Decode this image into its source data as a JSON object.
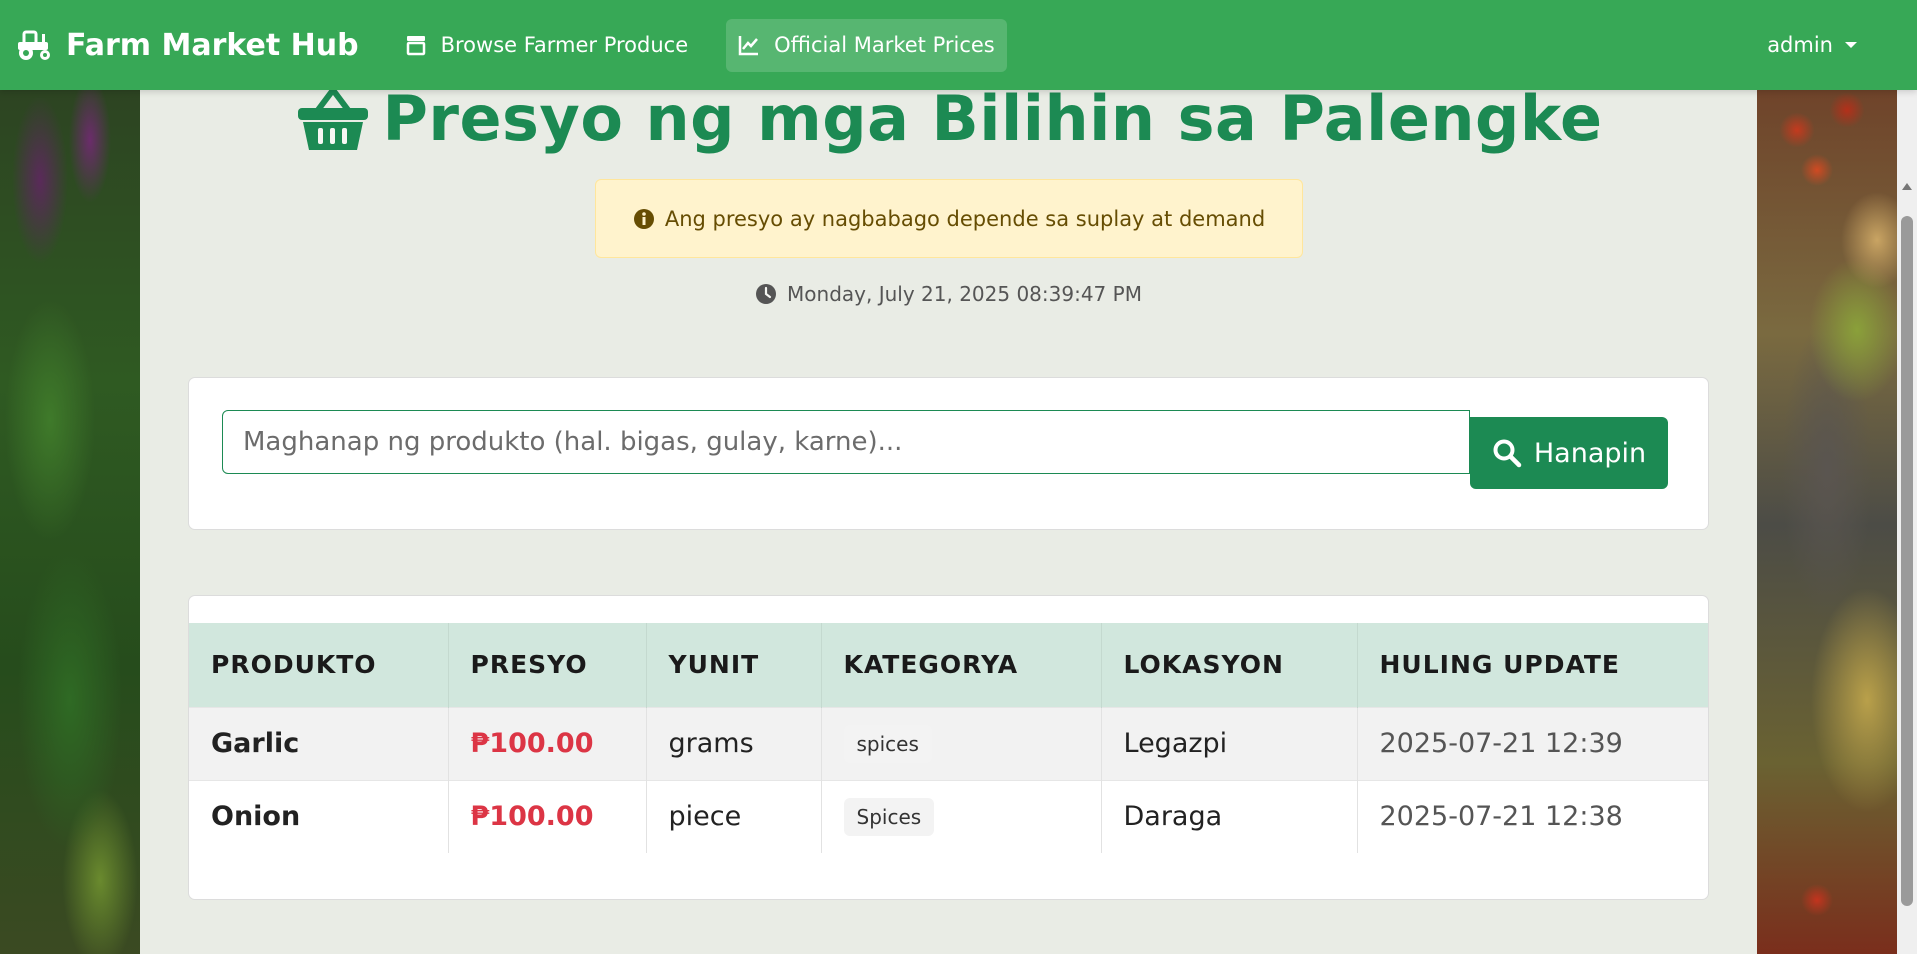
{
  "navbar": {
    "brand": "Farm Market Hub",
    "browse_label": "Browse Farmer Produce",
    "prices_label": "Official Market Prices",
    "user_label": "admin"
  },
  "main": {
    "title": "Presyo ng mga Bilihin sa Palengke",
    "notice": "Ang presyo ay nagbabago depende sa suplay at demand",
    "timestamp": "Monday, July 21, 2025 08:39:47 PM"
  },
  "search": {
    "placeholder": "Maghanap ng produkto (hal. bigas, gulay, karne)...",
    "button_label": "Hanapin"
  },
  "table": {
    "headers": [
      "PRODUKTO",
      "PRESYO",
      "YUNIT",
      "KATEGORYA",
      "LOKASYON",
      "HULING UPDATE"
    ],
    "rows": [
      {
        "product": "Garlic",
        "price": "₱100.00",
        "unit": "grams",
        "category": "spices",
        "location": "Legazpi",
        "updated": "2025-07-21 12:39"
      },
      {
        "product": "Onion",
        "price": "₱100.00",
        "unit": "piece",
        "category": "Spices",
        "location": "Daraga",
        "updated": "2025-07-21 12:38"
      }
    ]
  },
  "colors": {
    "navbar": "#37a856",
    "accent": "#1c8a53",
    "price": "#dc3545",
    "table_header": "#d1e7dd",
    "alert_bg": "#fff3cd"
  },
  "icons": {
    "brand": "tractor-icon",
    "browse": "store-icon",
    "prices": "chart-line-icon",
    "title": "basket-icon",
    "notice": "info-circle-icon",
    "timestamp": "clock-icon",
    "search": "search-icon"
  }
}
